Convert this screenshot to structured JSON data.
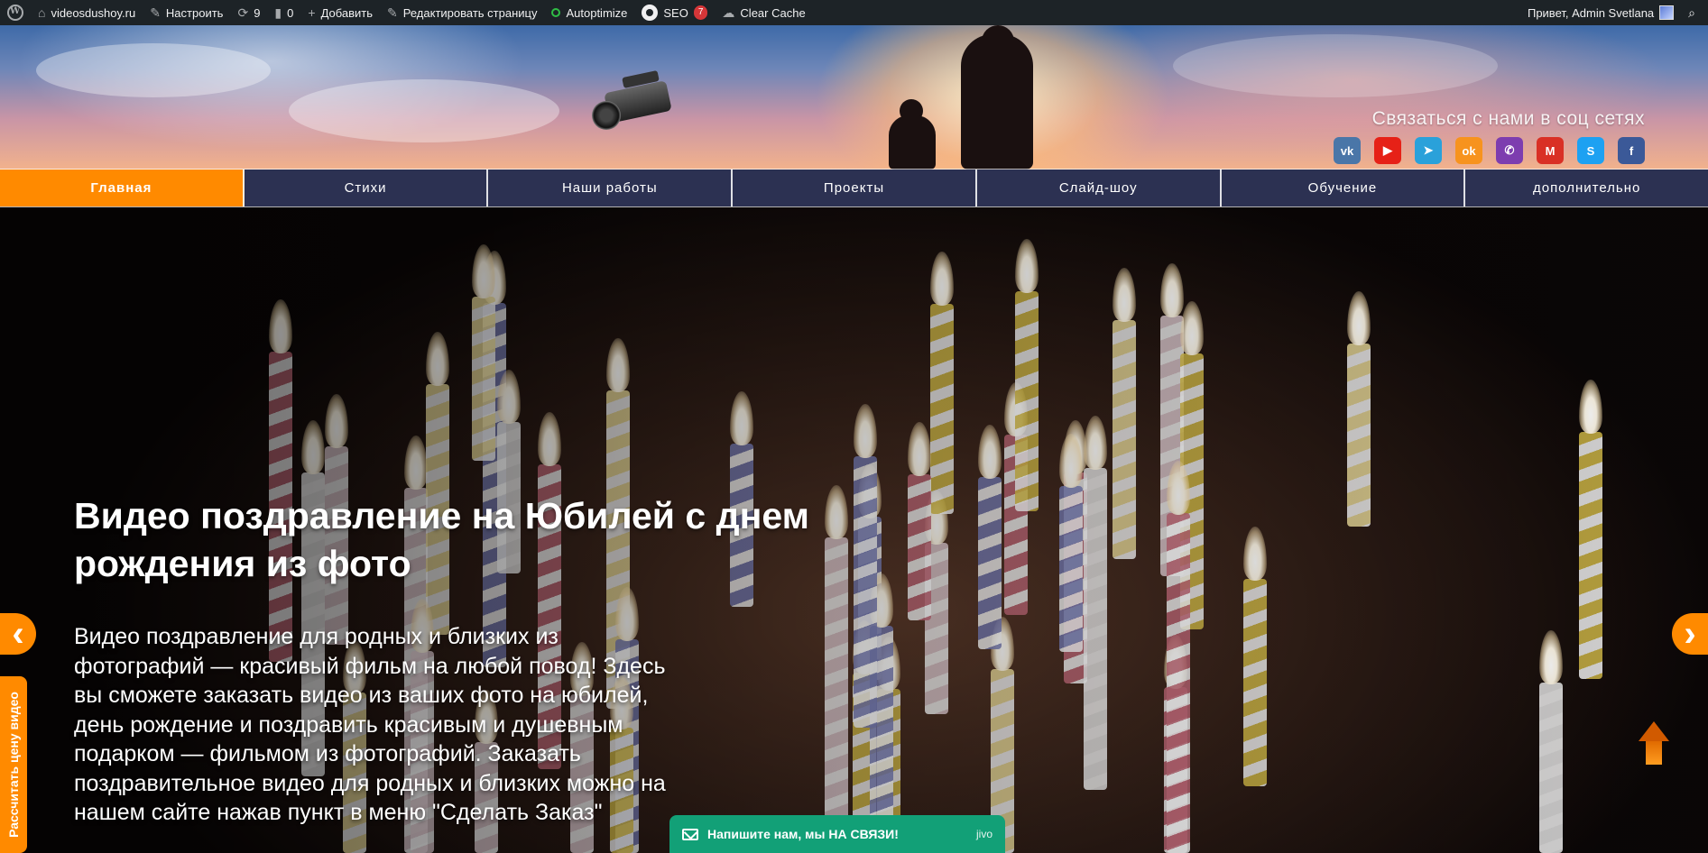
{
  "adminbar": {
    "site": "videosdushoy.ru",
    "customize": "Настроить",
    "updates_count": "9",
    "comments_count": "0",
    "add_new": "Добавить",
    "edit_page": "Редактировать страницу",
    "autoptimize": "Autoptimize",
    "seo": "SEO",
    "seo_count": "7",
    "clear_cache": "Clear Cache",
    "greeting": "Привет, Admin Svetlana"
  },
  "header": {
    "social_title": "Связаться с нами в соц сетях",
    "social_icons": [
      {
        "name": "vk-icon",
        "glyph": "vk",
        "color": "#4a76a8"
      },
      {
        "name": "youtube-icon",
        "glyph": "▶",
        "color": "#e62117"
      },
      {
        "name": "telegram-icon",
        "glyph": "➤",
        "color": "#2aa1da"
      },
      {
        "name": "odnoklassniki-icon",
        "glyph": "ok",
        "color": "#f7931e"
      },
      {
        "name": "viber-icon",
        "glyph": "✆",
        "color": "#7d3daf"
      },
      {
        "name": "gmail-icon",
        "glyph": "M",
        "color": "#d93025"
      },
      {
        "name": "skype-icon",
        "glyph": "S",
        "color": "#1da1f2"
      },
      {
        "name": "facebook-icon",
        "glyph": "f",
        "color": "#3b5998"
      }
    ]
  },
  "nav": {
    "items": [
      "Главная",
      "Стихи",
      "Наши работы",
      "Проекты",
      "Слайд-шоу",
      "Обучение",
      "дополнительно"
    ],
    "active_color": "#ff8a00"
  },
  "hero": {
    "title": "Видео поздравление на Юбилей с днем рождения из фото",
    "text": "Видео поздравление для родных и близких из фотографий — красивый фильм на любой повод! Здесь вы сможете заказать видео из ваших фото на юбилей, день рождение и поздравить красивым и душевным подарком — фильмом из фотографий. Заказать поздравительное видео для родных и близких можно на нашем сайте нажав пункт в меню \"Сделать Заказ\""
  },
  "side_tab": {
    "label": "Рассчитать цену видео"
  },
  "chat": {
    "label": "Напишите нам, мы НА СВЯЗИ!",
    "brand": "jivo"
  }
}
